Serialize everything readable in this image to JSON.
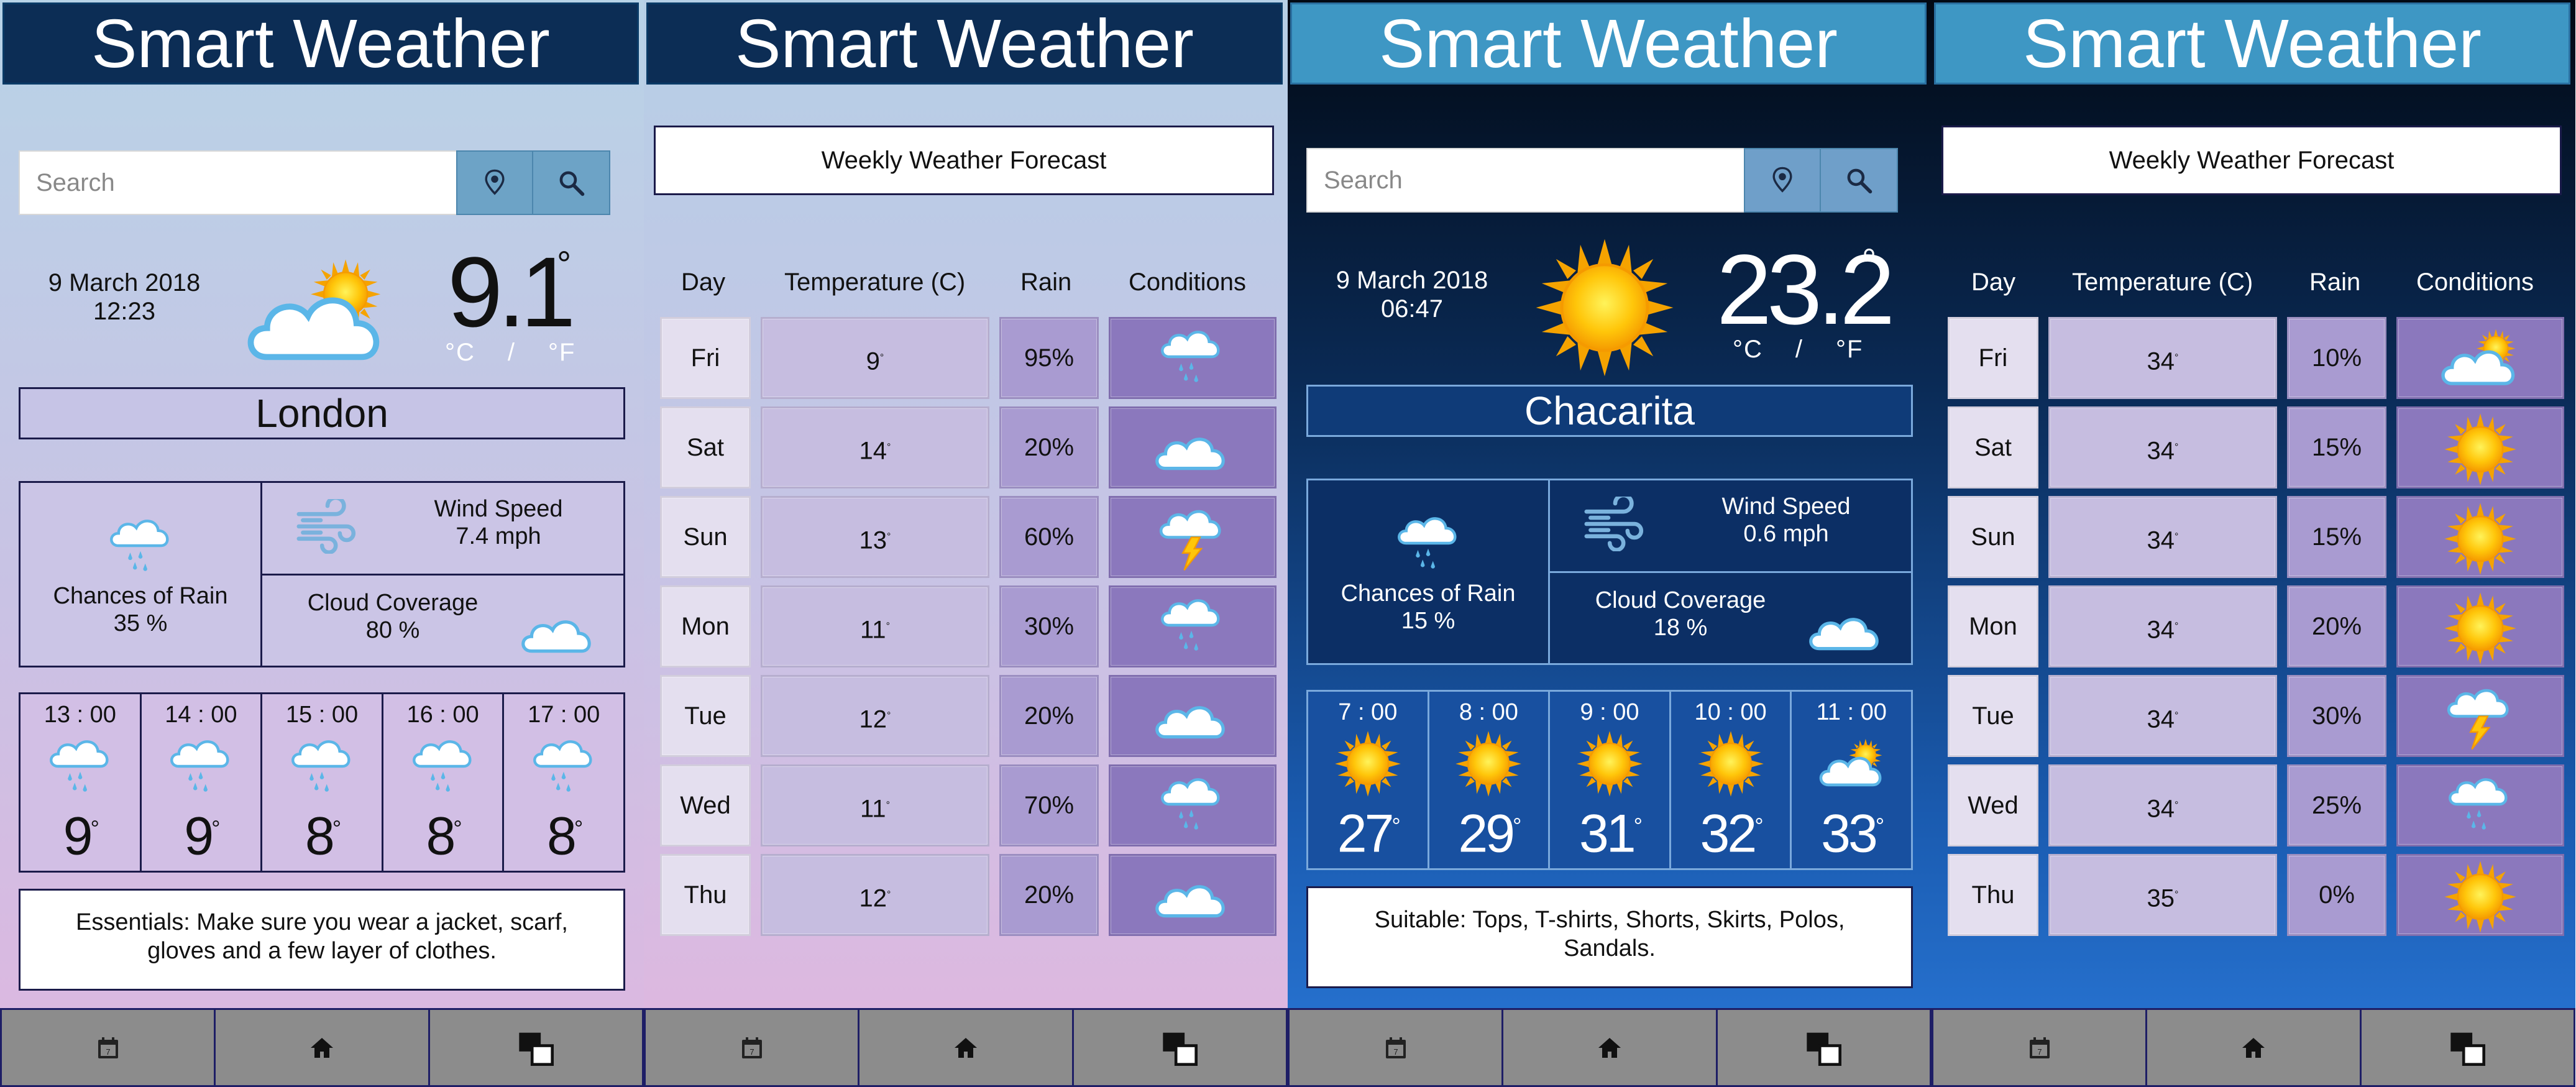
{
  "app_title": "Smart Weather",
  "nav_icons": [
    "calendar-icon",
    "home-icon",
    "window-switch-icon"
  ],
  "screens": [
    {
      "type": "current",
      "theme": "light",
      "search_placeholder": "Search",
      "date": "9 March 2018",
      "time": "12:23",
      "temperature": "9.1",
      "degree_symbol": "°",
      "unit_c": "°C",
      "unit_sep": "/",
      "unit_f": "°F",
      "main_icon": "partly-cloudy-icon",
      "city": "London",
      "rain_label": "Chances of Rain",
      "rain_value": "35 %",
      "wind_label": "Wind Speed",
      "wind_value": "7.4 mph",
      "cloud_label": "Cloud Coverage",
      "cloud_value": "80 %",
      "hourly": [
        {
          "time": "13 : 00",
          "temp": "9",
          "icon": "rain-cloud-icon"
        },
        {
          "time": "14 : 00",
          "temp": "9",
          "icon": "rain-cloud-icon"
        },
        {
          "time": "15 : 00",
          "temp": "8",
          "icon": "rain-cloud-icon"
        },
        {
          "time": "16 : 00",
          "temp": "8",
          "icon": "rain-cloud-icon"
        },
        {
          "time": "17 : 00",
          "temp": "8",
          "icon": "rain-cloud-icon"
        }
      ],
      "advice": "Essentials: Make sure you wear a jacket, scarf, gloves and a few layer of clothes."
    },
    {
      "type": "weekly",
      "theme": "light",
      "title": "Weekly Weather Forecast",
      "headers": [
        "Day",
        "Temperature (C)",
        "Rain",
        "Conditions"
      ],
      "rows": [
        {
          "day": "Fri",
          "temp": "9",
          "rain": "95%",
          "icon": "rain-cloud-icon"
        },
        {
          "day": "Sat",
          "temp": "14",
          "rain": "20%",
          "icon": "cloud-icon"
        },
        {
          "day": "Sun",
          "temp": "13",
          "rain": "60%",
          "icon": "thunder-cloud-icon"
        },
        {
          "day": "Mon",
          "temp": "11",
          "rain": "30%",
          "icon": "rain-cloud-icon"
        },
        {
          "day": "Tue",
          "temp": "12",
          "rain": "20%",
          "icon": "cloud-icon"
        },
        {
          "day": "Wed",
          "temp": "11",
          "rain": "70%",
          "icon": "rain-cloud-icon"
        },
        {
          "day": "Thu",
          "temp": "12",
          "rain": "20%",
          "icon": "cloud-icon"
        }
      ]
    },
    {
      "type": "current",
      "theme": "dark",
      "search_placeholder": "Search",
      "date": "9 March 2018",
      "time": "06:47",
      "temperature": "23.2",
      "degree_symbol": "°",
      "unit_c": "°C",
      "unit_sep": "/",
      "unit_f": "°F",
      "main_icon": "sun-icon",
      "city": "Chacarita",
      "rain_label": "Chances of Rain",
      "rain_value": "15 %",
      "wind_label": "Wind Speed",
      "wind_value": "0.6 mph",
      "cloud_label": "Cloud Coverage",
      "cloud_value": "18 %",
      "hourly": [
        {
          "time": "7 : 00",
          "temp": "27",
          "icon": "sun-icon"
        },
        {
          "time": "8 : 00",
          "temp": "29",
          "icon": "sun-icon"
        },
        {
          "time": "9 : 00",
          "temp": "31",
          "icon": "sun-icon"
        },
        {
          "time": "10 : 00",
          "temp": "32",
          "icon": "sun-icon"
        },
        {
          "time": "11 : 00",
          "temp": "33",
          "icon": "partly-cloudy-icon"
        }
      ],
      "advice": "Suitable: Tops, T-shirts, Shorts, Skirts, Polos, Sandals."
    },
    {
      "type": "weekly",
      "theme": "dark",
      "title": "Weekly Weather Forecast",
      "headers": [
        "Day",
        "Temperature (C)",
        "Rain",
        "Conditions"
      ],
      "rows": [
        {
          "day": "Fri",
          "temp": "34",
          "rain": "10%",
          "icon": "partly-cloudy-icon"
        },
        {
          "day": "Sat",
          "temp": "34",
          "rain": "15%",
          "icon": "sun-icon"
        },
        {
          "day": "Sun",
          "temp": "34",
          "rain": "15%",
          "icon": "sun-icon"
        },
        {
          "day": "Mon",
          "temp": "34",
          "rain": "20%",
          "icon": "sun-icon"
        },
        {
          "day": "Tue",
          "temp": "34",
          "rain": "30%",
          "icon": "thunder-cloud-icon"
        },
        {
          "day": "Wed",
          "temp": "34",
          "rain": "25%",
          "icon": "rain-cloud-icon"
        },
        {
          "day": "Thu",
          "temp": "35",
          "rain": "0%",
          "icon": "sun-icon"
        }
      ]
    }
  ],
  "colors": {
    "header_dark": "#0c2d55",
    "header_light": "#3e97c4",
    "search_button": "#6da3c6",
    "navbar": "#8c8c8c",
    "sun": "#ffc60a",
    "cloud_outline": "#5bb6e8"
  }
}
